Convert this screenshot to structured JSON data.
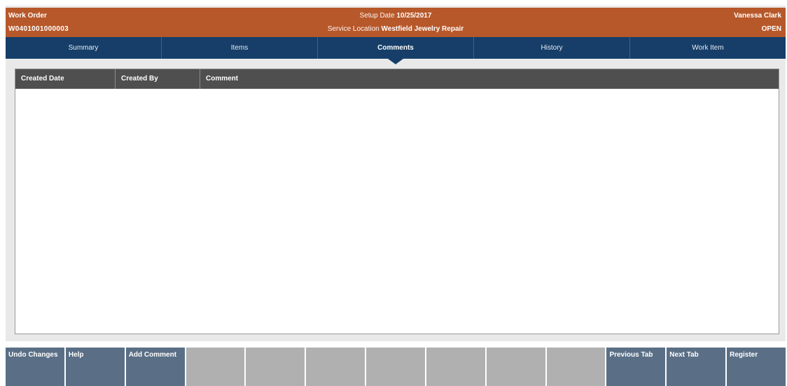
{
  "header": {
    "doc_type": "Work Order",
    "order_number": "W0401001000003",
    "setup_date_label": "Setup Date",
    "setup_date": "10/25/2017",
    "service_location_label": "Service Location",
    "service_location": "Westfield Jewelry Repair",
    "user": "Vanessa Clark",
    "status": "OPEN"
  },
  "tabs": [
    {
      "label": "Summary",
      "active": false
    },
    {
      "label": "Items",
      "active": false
    },
    {
      "label": "Comments",
      "active": true
    },
    {
      "label": "History",
      "active": false
    },
    {
      "label": "Work Item",
      "active": false
    }
  ],
  "table": {
    "columns": [
      "Created Date",
      "Created By",
      "Comment"
    ],
    "rows": []
  },
  "footer": {
    "buttons": [
      {
        "label": "Undo Changes",
        "enabled": true
      },
      {
        "label": "Help",
        "enabled": true
      },
      {
        "label": "Add Comment",
        "enabled": true
      },
      {
        "label": "",
        "enabled": false
      },
      {
        "label": "",
        "enabled": false
      },
      {
        "label": "",
        "enabled": false
      },
      {
        "label": "",
        "enabled": false
      },
      {
        "label": "",
        "enabled": false
      },
      {
        "label": "",
        "enabled": false
      },
      {
        "label": "",
        "enabled": false
      },
      {
        "label": "Previous Tab",
        "enabled": true
      },
      {
        "label": "Next Tab",
        "enabled": true
      },
      {
        "label": "Register",
        "enabled": true
      }
    ]
  },
  "colors": {
    "header_bg": "#b7582a",
    "tab_bg": "#163e68",
    "table_header_bg": "#4f4f4f",
    "button_bg": "#5a6f86",
    "button_disabled_bg": "#b0b0b0"
  }
}
